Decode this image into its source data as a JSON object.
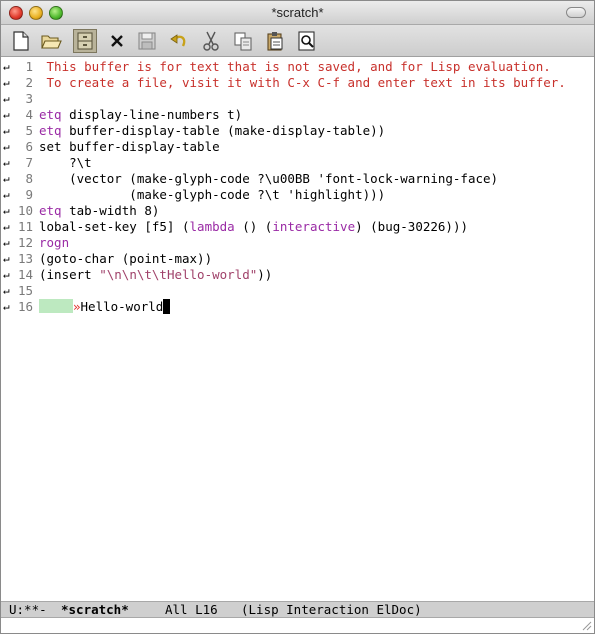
{
  "window": {
    "title": "*scratch*"
  },
  "toolbar": {
    "buttons": [
      {
        "name": "new-file",
        "icon": "new-file-icon"
      },
      {
        "name": "open",
        "icon": "folder-open-icon"
      },
      {
        "name": "dired",
        "icon": "cabinet-icon"
      },
      {
        "name": "kill-buffer",
        "icon": "close-x-icon"
      },
      {
        "name": "save",
        "icon": "save-icon"
      },
      {
        "name": "undo",
        "icon": "undo-icon"
      },
      {
        "name": "cut",
        "icon": "scissors-icon"
      },
      {
        "name": "copy",
        "icon": "copy-icon"
      },
      {
        "name": "paste",
        "icon": "paste-icon"
      },
      {
        "name": "search",
        "icon": "search-icon"
      }
    ]
  },
  "buffer": {
    "lines": [
      {
        "n": "1",
        "parts": [
          {
            "t": " This buffer is for text that is not saved, and for Lisp evaluation.",
            "c": "comment"
          }
        ]
      },
      {
        "n": "2",
        "parts": [
          {
            "t": " To create a file, visit it with C-x C-f and enter text in its buffer.",
            "c": "comment"
          }
        ]
      },
      {
        "n": "3",
        "parts": []
      },
      {
        "n": "4",
        "parts": [
          {
            "t": "etq",
            "c": "kw"
          },
          {
            "t": " display-line-numbers t)",
            "c": ""
          }
        ]
      },
      {
        "n": "5",
        "parts": [
          {
            "t": "etq",
            "c": "kw"
          },
          {
            "t": " buffer-display-table (make-display-table))",
            "c": ""
          }
        ]
      },
      {
        "n": "6",
        "parts": [
          {
            "t": "set buffer-display-table",
            "c": ""
          }
        ]
      },
      {
        "n": "7",
        "parts": [
          {
            "t": "    ?\\t",
            "c": ""
          }
        ]
      },
      {
        "n": "8",
        "parts": [
          {
            "t": "    (vector (make-glyph-code ?\\u00BB 'font-lock-warning-face)",
            "c": ""
          }
        ]
      },
      {
        "n": "9",
        "parts": [
          {
            "t": "            (make-glyph-code ?\\t 'highlight)))",
            "c": ""
          }
        ]
      },
      {
        "n": "10",
        "parts": [
          {
            "t": "etq",
            "c": "kw"
          },
          {
            "t": " tab-width 8)",
            "c": ""
          }
        ]
      },
      {
        "n": "11",
        "parts": [
          {
            "t": "lobal-set-key [f5] (",
            "c": ""
          },
          {
            "t": "lambda",
            "c": "kw"
          },
          {
            "t": " () (",
            "c": ""
          },
          {
            "t": "interactive",
            "c": "kw"
          },
          {
            "t": ") (bug-30226)))",
            "c": ""
          }
        ]
      },
      {
        "n": "12",
        "parts": [
          {
            "t": "rogn",
            "c": "kw"
          }
        ]
      },
      {
        "n": "13",
        "parts": [
          {
            "t": "(goto-char (point-max))",
            "c": ""
          }
        ]
      },
      {
        "n": "14",
        "parts": [
          {
            "t": "(insert ",
            "c": ""
          },
          {
            "t": "\"\\n\\n\\t\\tHello-world\"",
            "c": "str"
          },
          {
            "t": "))",
            "c": ""
          }
        ]
      },
      {
        "n": "15",
        "parts": []
      },
      {
        "n": "16",
        "parts": [
          {
            "t": "",
            "c": "tabhl"
          },
          {
            "t": "»",
            "c": "raquo"
          },
          {
            "t": "Hello-world",
            "c": ""
          },
          {
            "t": "",
            "c": "cursor"
          }
        ]
      }
    ]
  },
  "modeline": {
    "status": "U:**-",
    "buffer_name": "*scratch*",
    "position": "All L16",
    "modes": "(Lisp Interaction ElDoc)"
  }
}
